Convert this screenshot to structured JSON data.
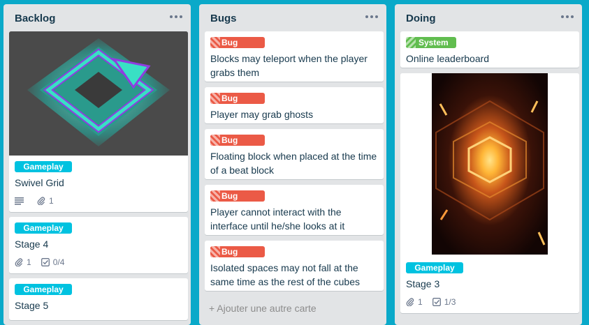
{
  "lists": [
    {
      "title": "Backlog",
      "cards": [
        {
          "label": "Gameplay",
          "title": "Swivel Grid",
          "attachments": "1"
        },
        {
          "label": "Gameplay",
          "title": "Stage 4",
          "attachments": "1",
          "checklist": "0/4"
        },
        {
          "label": "Gameplay",
          "title": "Stage 5"
        }
      ]
    },
    {
      "title": "Bugs",
      "cards": [
        {
          "label": "Bug",
          "title": "Blocks may teleport when the player grabs them"
        },
        {
          "label": "Bug",
          "title": "Player may grab ghosts"
        },
        {
          "label": "Bug",
          "title": "Floating block when placed at the time of a beat block"
        },
        {
          "label": "Bug",
          "title": "Player cannot interact with the interface until he/she looks at it"
        },
        {
          "label": "Bug",
          "title": "Isolated spaces may not fall at the same time as the rest of the cubes"
        }
      ],
      "add_card": "+ Ajouter une autre carte"
    },
    {
      "title": "Doing",
      "cards": [
        {
          "label": "System",
          "title": "Online leaderboard"
        },
        {
          "label": "Gameplay",
          "title": "Stage 3",
          "attachments": "1",
          "checklist": "1/3"
        }
      ]
    }
  ],
  "colors": {
    "board_bg": "#0aa9c9",
    "list_bg": "#e2e4e6",
    "label_gameplay": "#00c2e0",
    "label_bug": "#eb5a46",
    "label_system": "#61bd4f"
  },
  "icons": [
    "more-icon",
    "description-icon",
    "paperclip-icon",
    "checklist-icon"
  ]
}
